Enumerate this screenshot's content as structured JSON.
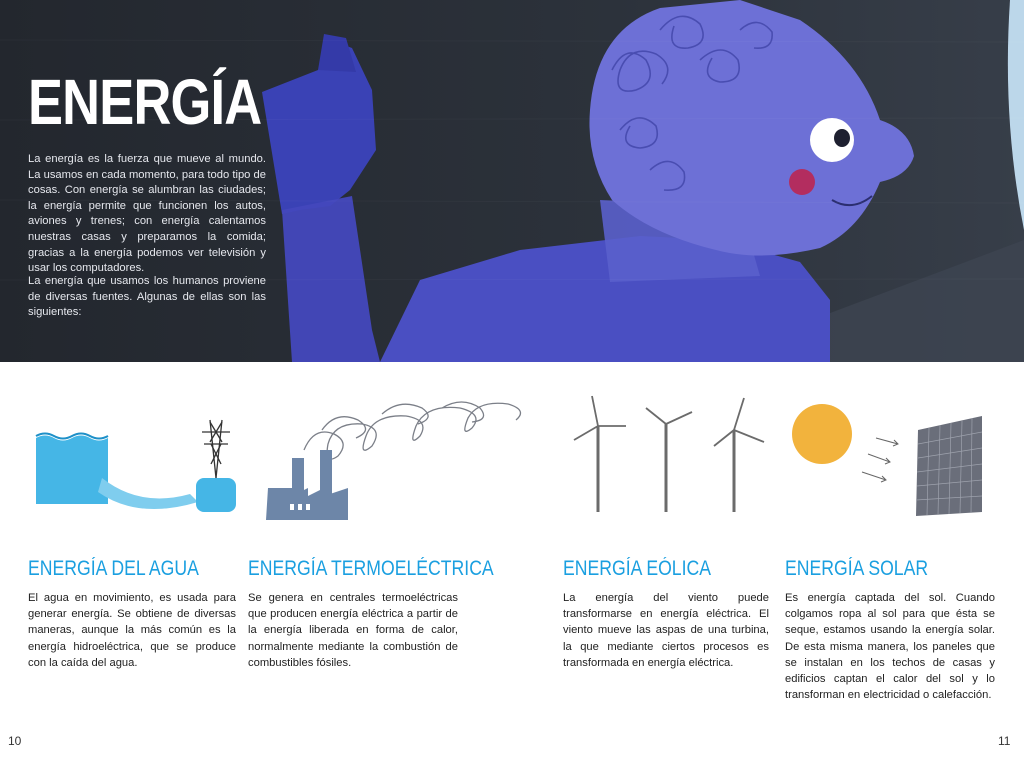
{
  "header": {
    "title": "ENERGÍA",
    "intro_paragraphs": [
      "La energía es la fuerza que mueve al mundo. La usamos en cada momento, para todo tipo de cosas. Con energía se alumbran las ciudades; la energía permite que funcionen los autos, aviones y trenes; con energía calentamos nuestras casas y preparamos la comida; gracias a la energía podemos ver televisión y usar los computadores.",
      "La energía que usamos los humanos proviene de diversas fuentes. Algunas de ellas son las siguientes:"
    ]
  },
  "sections": [
    {
      "title": "ENERGÍA DEL AGUA",
      "body": "El agua en movimiento, es usada para generar energía. Se obtiene de diversas maneras, aunque la más común es la energía hidroeléctrica, que se produce con la caída del agua."
    },
    {
      "title": "ENERGÍA TERMOELÉCTRICA",
      "body": "Se genera en centrales termoeléctricas que producen energía eléctrica a partir de la energía liberada en forma de calor, normalmente mediante la combustión de combustibles fósiles."
    },
    {
      "title": "ENERGÍA EÓLICA",
      "body": "La energía del viento puede transformarse en energía eléctrica. El viento mueve las aspas de una turbina, la que mediante ciertos procesos es transformada en energía eléctrica."
    },
    {
      "title": "ENERGÍA SOLAR",
      "body": "Es energía captada del sol. Cuando colgamos ropa al sol para que ésta se seque, estamos usando la energía solar. De esta misma manera, los paneles que se instalan en los techos de casas y edificios captan el calor del sol y lo transforman en electricidad o calefacción."
    }
  ],
  "page_numbers": {
    "left": "10",
    "right": "11"
  },
  "colors": {
    "accent": "#1a9fe0",
    "hero_background": "#262b33",
    "figure_blue": "#4d52c4",
    "water_blue": "#45b6e6",
    "sun_orange": "#f2b33d",
    "factory_slate": "#6d86a8"
  }
}
